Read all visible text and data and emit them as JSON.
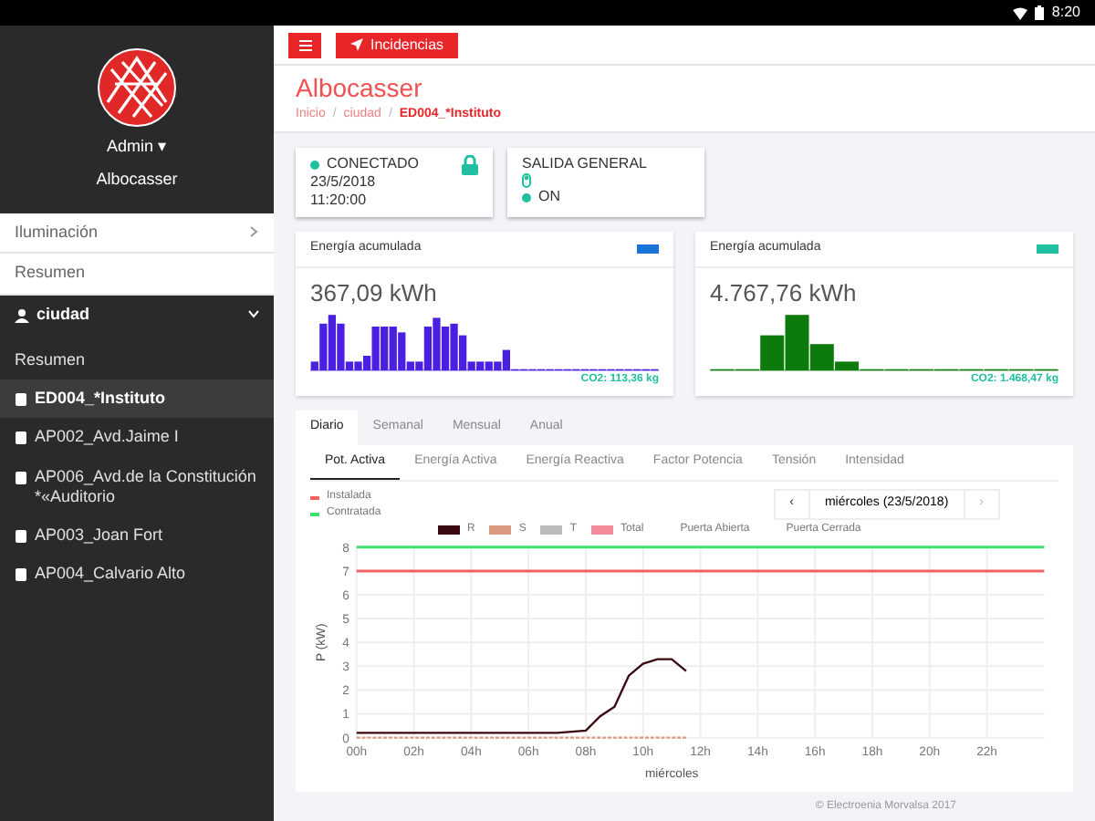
{
  "status_bar": {
    "time": "8:20"
  },
  "sidebar": {
    "user": "Admin ▾",
    "place": "Albocasser",
    "items": [
      {
        "label": "Iluminación",
        "selected": false,
        "expanded": false,
        "kind": "group"
      },
      {
        "label": "Resumen",
        "selected": false,
        "kind": "link"
      },
      {
        "label": "ciudad",
        "selected": false,
        "expanded": true,
        "kind": "group",
        "children": [
          {
            "label": "Resumen",
            "selected": false,
            "kind": "link"
          },
          {
            "label": "ED004_*Instituto",
            "selected": true,
            "kind": "device"
          },
          {
            "label": "AP002_Avd.Jaime I",
            "selected": false,
            "kind": "device"
          },
          {
            "label": "AP006_Avd.de la Constitución *«Auditorio",
            "selected": false,
            "kind": "device"
          },
          {
            "label": "AP003_Joan Fort",
            "selected": false,
            "kind": "device"
          },
          {
            "label": "AP004_Calvario Alto",
            "selected": false,
            "kind": "device"
          }
        ]
      }
    ]
  },
  "toolbar": {
    "incidents_button": "Incidencias"
  },
  "page": {
    "title": "Albocasser",
    "breadcrumb": {
      "separator": "/",
      "items": [
        "Inicio",
        "ciudad",
        "ED004_*Instituto"
      ]
    }
  },
  "connection": {
    "status": "CONECTADO",
    "date": "23/5/2018",
    "time": "11:20:00",
    "locked": true
  },
  "output": {
    "title": "SALIDA GENERAL",
    "state": "ON",
    "on": true
  },
  "energy_cards": [
    {
      "title": "Energía acumulada",
      "value": "367,09 kWh",
      "co2": "CO2: 113,36 kg",
      "color": "#4b1fe0"
    },
    {
      "title": "Energía acumulada",
      "value": "4.767,76 kWh",
      "co2": "CO2: 1.468,47 kg",
      "color": "#0c7a0c"
    }
  ],
  "period_tabs": [
    {
      "label": "Diario",
      "selected": true
    },
    {
      "label": "Semanal",
      "selected": false
    },
    {
      "label": "Mensual",
      "selected": false
    },
    {
      "label": "Anual",
      "selected": false
    }
  ],
  "measure_tabs": [
    {
      "label": "Pot. Activa",
      "selected": true
    },
    {
      "label": "Energía Activa",
      "selected": false
    },
    {
      "label": "Energía Reactiva",
      "selected": false
    },
    {
      "label": "Factor Potencia",
      "selected": false
    },
    {
      "label": "Tensión",
      "selected": false
    },
    {
      "label": "Intensidad",
      "selected": false
    }
  ],
  "date_nav": {
    "prev": "‹",
    "date": "miércoles (23/5/2018)",
    "next": "›"
  },
  "series_legend": [
    {
      "label": "T",
      "color": "#bbbbbb",
      "kind": "box"
    },
    {
      "label": "Total",
      "color": "#f48a9a",
      "kind": "box"
    },
    {
      "label": "Puerta Abierta",
      "kind": "text"
    },
    {
      "label": "Puerta Cerrada",
      "kind": "text"
    }
  ],
  "chart_data": {
    "type": "line",
    "xlabel": "miércoles",
    "ylabel": "P (kW)",
    "grid": true,
    "x": [
      0,
      1,
      2,
      3,
      4,
      5,
      6,
      7,
      8,
      8.5,
      9,
      9.5,
      10,
      10.5,
      11,
      11.5,
      12,
      14,
      16,
      18,
      20,
      22,
      24
    ],
    "series": [
      {
        "name": "Instalada",
        "color": "#f26060",
        "line_style": "solid",
        "values": [
          7,
          7,
          7,
          7,
          7,
          7,
          7,
          7,
          7,
          7,
          7,
          7,
          7,
          7,
          7,
          7,
          7,
          7,
          7,
          7,
          7,
          7,
          7
        ]
      },
      {
        "name": "Contratada",
        "color": "#40e070",
        "line_style": "solid",
        "values": [
          8,
          8,
          8,
          8,
          8,
          8,
          8,
          8,
          8,
          8,
          8,
          8,
          8,
          8,
          8,
          8,
          8,
          8,
          8,
          8,
          8,
          8,
          8
        ]
      },
      {
        "name": "R",
        "color": "#3a0a10",
        "line_style": "solid",
        "values": [
          0.2,
          0.2,
          0.2,
          0.2,
          0.2,
          0.2,
          0.2,
          0.2,
          0.3,
          0.9,
          1.3,
          2.6,
          3.1,
          3.3,
          3.3,
          2.8,
          null,
          null,
          null,
          null,
          null,
          null,
          null
        ]
      },
      {
        "name": "S",
        "color": "#d99a80",
        "line_style": "dashed",
        "values": [
          0,
          0,
          0,
          0,
          0,
          0,
          0,
          0,
          0,
          0,
          0,
          0,
          0,
          0,
          0,
          0,
          null,
          null,
          null,
          null,
          null,
          null,
          null
        ]
      }
    ],
    "xlim": [
      0,
      24
    ],
    "ylim": [
      0,
      8
    ],
    "xticks": [
      {
        "value": 0,
        "label": "00h"
      },
      {
        "value": 2,
        "label": "02h"
      },
      {
        "value": 4,
        "label": "04h"
      },
      {
        "value": 6,
        "label": "06h"
      },
      {
        "value": 8,
        "label": "08h"
      },
      {
        "value": 10,
        "label": "10h"
      },
      {
        "value": 12,
        "label": "12h"
      },
      {
        "value": 14,
        "label": "14h"
      },
      {
        "value": 16,
        "label": "16h"
      },
      {
        "value": 18,
        "label": "18h"
      },
      {
        "value": 20,
        "label": "20h"
      },
      {
        "value": 22,
        "label": "22h"
      }
    ],
    "yticks": [
      0,
      1,
      2,
      3,
      4,
      5,
      6,
      7,
      8
    ]
  },
  "footer": "© Electroenia Morvalsa 2017"
}
